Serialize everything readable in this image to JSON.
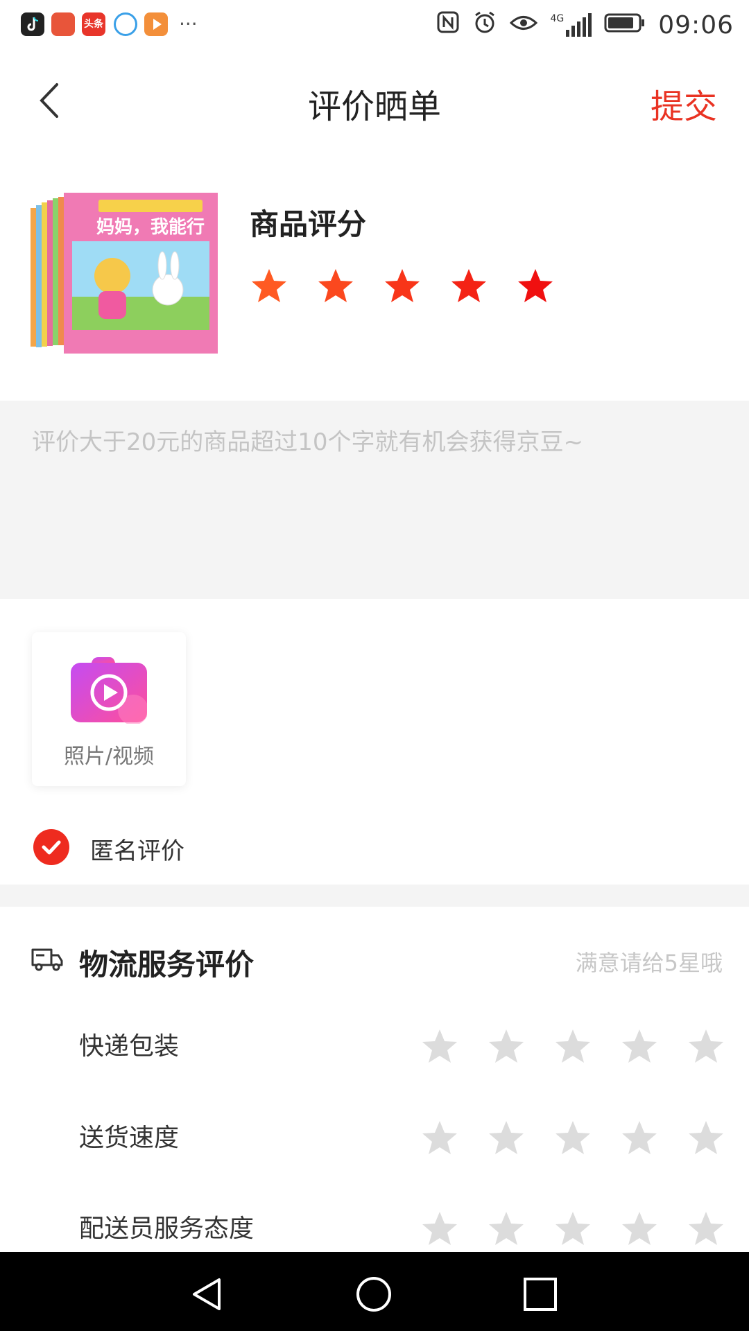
{
  "status_bar": {
    "time": "09:06",
    "network": "4G",
    "app_icons": [
      "douyin-icon",
      "jd-icon",
      "toutiao-icon",
      "browser-icon",
      "video-icon",
      "more-dots-icon"
    ]
  },
  "navbar": {
    "title": "评价晒单",
    "submit_label": "提交"
  },
  "product": {
    "rating_title": "商品评分",
    "rating_value": 5,
    "rating_max": 5,
    "cover_title": "妈妈，我能行"
  },
  "review": {
    "placeholder": "评价大于20元的商品超过10个字就有机会获得京豆~",
    "value": ""
  },
  "upload": {
    "label": "照片/视频"
  },
  "anonymous": {
    "label": "匿名评价",
    "checked": true
  },
  "logistics": {
    "title": "物流服务评价",
    "hint": "满意请给5星哦",
    "rows": [
      {
        "label": "快递包装",
        "rating": 0
      },
      {
        "label": "送货速度",
        "rating": 0
      },
      {
        "label": "配送员服务态度",
        "rating": 0
      }
    ]
  },
  "colors": {
    "accent": "#e93323",
    "star_active_start": "#ff5a22",
    "star_active_end": "#f01010",
    "star_inactive": "#dcdcdc",
    "placeholder": "#c4c4c4"
  }
}
